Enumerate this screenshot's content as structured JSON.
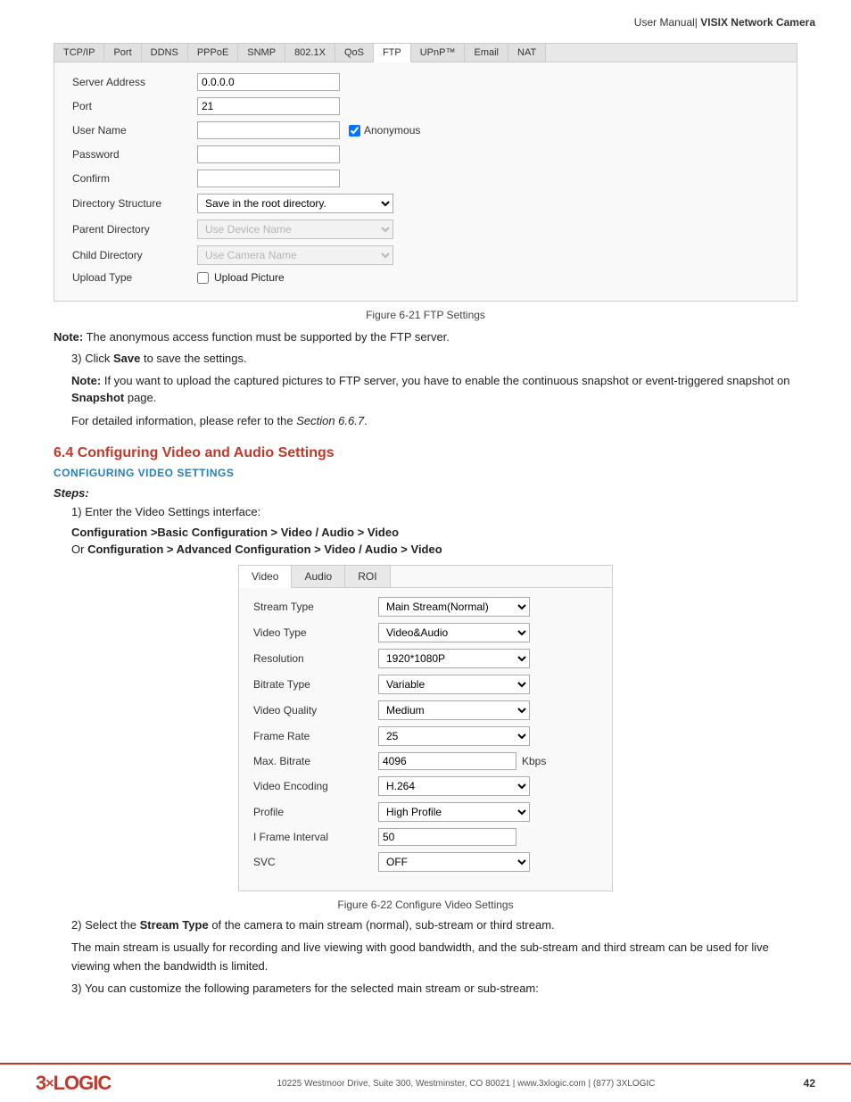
{
  "header": {
    "text": "User Manual|",
    "bold": " VISIX Network Camera"
  },
  "ftp_panel": {
    "tabs": [
      "TCP/IP",
      "Port",
      "DDNS",
      "PPPoE",
      "SNMP",
      "802.1X",
      "QoS",
      "FTP",
      "UPnP™",
      "Email",
      "NAT"
    ],
    "active_tab": "FTP",
    "fields": [
      {
        "label": "Server Address",
        "type": "input",
        "value": "0.0.0.0"
      },
      {
        "label": "Port",
        "type": "input",
        "value": "21"
      },
      {
        "label": "User Name",
        "type": "input_checkbox",
        "value": "",
        "checkbox_label": "Anonymous",
        "checked": true
      },
      {
        "label": "Password",
        "type": "input",
        "value": ""
      },
      {
        "label": "Confirm",
        "type": "input",
        "value": ""
      },
      {
        "label": "Directory Structure",
        "type": "select",
        "value": "Save in the root directory."
      },
      {
        "label": "Parent Directory",
        "type": "select_disabled",
        "value": "Use Device Name"
      },
      {
        "label": "Child Directory",
        "type": "select_disabled",
        "value": "Use Camera Name"
      },
      {
        "label": "Upload Type",
        "type": "checkbox_label",
        "checkbox_label": "Upload Picture"
      }
    ],
    "caption": "Figure 6-21 FTP Settings"
  },
  "note1": {
    "bold": "Note:",
    "text": " The anonymous access function must be supported by the FTP server."
  },
  "step3": {
    "num": "3)",
    "text": "Click ",
    "bold": "Save",
    "text2": " to save the settings."
  },
  "note2": {
    "bold": "Note:",
    "text": " If you want to upload the captured pictures to FTP server, you have to enable the continuous snapshot or event-triggered snapshot on ",
    "bold2": "Snapshot",
    "text2": " page."
  },
  "note3": {
    "text": "For detailed information, please refer to the ",
    "italic": "Section 6.6.7",
    "text2": "."
  },
  "section": {
    "num": "6.4",
    "title": " Configuring Video and Audio Settings"
  },
  "subsection": {
    "title": "CONFIGURING VIDEO SETTINGS"
  },
  "steps_label": "Steps:",
  "step1": {
    "num": "1)",
    "text": "Enter the Video Settings interface:"
  },
  "path1": {
    "bold": "Configuration >Basic Configuration > Video / Audio > Video"
  },
  "path2": {
    "text": "Or ",
    "bold": "Configuration > Advanced Configuration > Video / Audio > Video"
  },
  "video_panel": {
    "tabs": [
      "Video",
      "Audio",
      "ROI"
    ],
    "active_tab": "Video",
    "fields": [
      {
        "label": "Stream Type",
        "type": "select",
        "value": "Main Stream(Normal)"
      },
      {
        "label": "Video Type",
        "type": "select",
        "value": "Video&Audio"
      },
      {
        "label": "Resolution",
        "type": "select",
        "value": "1920*1080P"
      },
      {
        "label": "Bitrate Type",
        "type": "select",
        "value": "Variable"
      },
      {
        "label": "Video Quality",
        "type": "select",
        "value": "Medium"
      },
      {
        "label": "Frame Rate",
        "type": "select",
        "value": "25"
      },
      {
        "label": "Max. Bitrate",
        "type": "input_kbps",
        "value": "4096",
        "unit": "Kbps"
      },
      {
        "label": "Video Encoding",
        "type": "select",
        "value": "H.264"
      },
      {
        "label": "Profile",
        "type": "select",
        "value": "High Profile"
      },
      {
        "label": "I Frame Interval",
        "type": "input",
        "value": "50"
      },
      {
        "label": "SVC",
        "type": "select",
        "value": "OFF"
      }
    ],
    "caption": "Figure 6-22 Configure Video Settings"
  },
  "step2": {
    "num": "2)",
    "text": "Select the ",
    "bold": "Stream Type",
    "text2": " of the camera to main stream (normal), sub-stream or third stream."
  },
  "para1": {
    "text": "The main stream is usually for recording and live viewing with good bandwidth, and the sub-stream and third stream can be used for live viewing when the bandwidth is limited."
  },
  "step3b": {
    "num": "3)",
    "text": "You can customize the following parameters for the selected main stream or sub-stream:"
  },
  "footer": {
    "logo": "3×LOGIC",
    "address": "10225 Westmoor Drive, Suite 300, Westminster, CO 80021 | www.3xlogic.com | (877) 3XLOGIC",
    "page": "42"
  }
}
